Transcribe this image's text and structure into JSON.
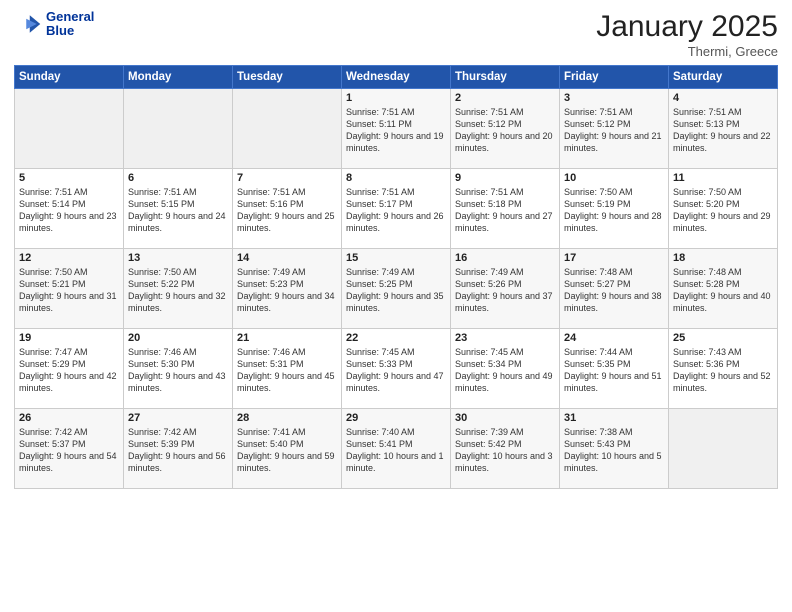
{
  "header": {
    "logo_line1": "General",
    "logo_line2": "Blue",
    "month": "January 2025",
    "location": "Thermi, Greece"
  },
  "weekdays": [
    "Sunday",
    "Monday",
    "Tuesday",
    "Wednesday",
    "Thursday",
    "Friday",
    "Saturday"
  ],
  "weeks": [
    [
      {
        "day": "",
        "empty": true
      },
      {
        "day": "",
        "empty": true
      },
      {
        "day": "",
        "empty": true
      },
      {
        "day": "1",
        "sunrise": "7:51 AM",
        "sunset": "5:11 PM",
        "daylight": "9 hours and 19 minutes."
      },
      {
        "day": "2",
        "sunrise": "7:51 AM",
        "sunset": "5:12 PM",
        "daylight": "9 hours and 20 minutes."
      },
      {
        "day": "3",
        "sunrise": "7:51 AM",
        "sunset": "5:12 PM",
        "daylight": "9 hours and 21 minutes."
      },
      {
        "day": "4",
        "sunrise": "7:51 AM",
        "sunset": "5:13 PM",
        "daylight": "9 hours and 22 minutes."
      }
    ],
    [
      {
        "day": "5",
        "sunrise": "7:51 AM",
        "sunset": "5:14 PM",
        "daylight": "9 hours and 23 minutes."
      },
      {
        "day": "6",
        "sunrise": "7:51 AM",
        "sunset": "5:15 PM",
        "daylight": "9 hours and 24 minutes."
      },
      {
        "day": "7",
        "sunrise": "7:51 AM",
        "sunset": "5:16 PM",
        "daylight": "9 hours and 25 minutes."
      },
      {
        "day": "8",
        "sunrise": "7:51 AM",
        "sunset": "5:17 PM",
        "daylight": "9 hours and 26 minutes."
      },
      {
        "day": "9",
        "sunrise": "7:51 AM",
        "sunset": "5:18 PM",
        "daylight": "9 hours and 27 minutes."
      },
      {
        "day": "10",
        "sunrise": "7:50 AM",
        "sunset": "5:19 PM",
        "daylight": "9 hours and 28 minutes."
      },
      {
        "day": "11",
        "sunrise": "7:50 AM",
        "sunset": "5:20 PM",
        "daylight": "9 hours and 29 minutes."
      }
    ],
    [
      {
        "day": "12",
        "sunrise": "7:50 AM",
        "sunset": "5:21 PM",
        "daylight": "9 hours and 31 minutes."
      },
      {
        "day": "13",
        "sunrise": "7:50 AM",
        "sunset": "5:22 PM",
        "daylight": "9 hours and 32 minutes."
      },
      {
        "day": "14",
        "sunrise": "7:49 AM",
        "sunset": "5:23 PM",
        "daylight": "9 hours and 34 minutes."
      },
      {
        "day": "15",
        "sunrise": "7:49 AM",
        "sunset": "5:25 PM",
        "daylight": "9 hours and 35 minutes."
      },
      {
        "day": "16",
        "sunrise": "7:49 AM",
        "sunset": "5:26 PM",
        "daylight": "9 hours and 37 minutes."
      },
      {
        "day": "17",
        "sunrise": "7:48 AM",
        "sunset": "5:27 PM",
        "daylight": "9 hours and 38 minutes."
      },
      {
        "day": "18",
        "sunrise": "7:48 AM",
        "sunset": "5:28 PM",
        "daylight": "9 hours and 40 minutes."
      }
    ],
    [
      {
        "day": "19",
        "sunrise": "7:47 AM",
        "sunset": "5:29 PM",
        "daylight": "9 hours and 42 minutes."
      },
      {
        "day": "20",
        "sunrise": "7:46 AM",
        "sunset": "5:30 PM",
        "daylight": "9 hours and 43 minutes."
      },
      {
        "day": "21",
        "sunrise": "7:46 AM",
        "sunset": "5:31 PM",
        "daylight": "9 hours and 45 minutes."
      },
      {
        "day": "22",
        "sunrise": "7:45 AM",
        "sunset": "5:33 PM",
        "daylight": "9 hours and 47 minutes."
      },
      {
        "day": "23",
        "sunrise": "7:45 AM",
        "sunset": "5:34 PM",
        "daylight": "9 hours and 49 minutes."
      },
      {
        "day": "24",
        "sunrise": "7:44 AM",
        "sunset": "5:35 PM",
        "daylight": "9 hours and 51 minutes."
      },
      {
        "day": "25",
        "sunrise": "7:43 AM",
        "sunset": "5:36 PM",
        "daylight": "9 hours and 52 minutes."
      }
    ],
    [
      {
        "day": "26",
        "sunrise": "7:42 AM",
        "sunset": "5:37 PM",
        "daylight": "9 hours and 54 minutes."
      },
      {
        "day": "27",
        "sunrise": "7:42 AM",
        "sunset": "5:39 PM",
        "daylight": "9 hours and 56 minutes."
      },
      {
        "day": "28",
        "sunrise": "7:41 AM",
        "sunset": "5:40 PM",
        "daylight": "9 hours and 59 minutes."
      },
      {
        "day": "29",
        "sunrise": "7:40 AM",
        "sunset": "5:41 PM",
        "daylight": "10 hours and 1 minute."
      },
      {
        "day": "30",
        "sunrise": "7:39 AM",
        "sunset": "5:42 PM",
        "daylight": "10 hours and 3 minutes."
      },
      {
        "day": "31",
        "sunrise": "7:38 AM",
        "sunset": "5:43 PM",
        "daylight": "10 hours and 5 minutes."
      },
      {
        "day": "",
        "empty": true
      }
    ]
  ]
}
